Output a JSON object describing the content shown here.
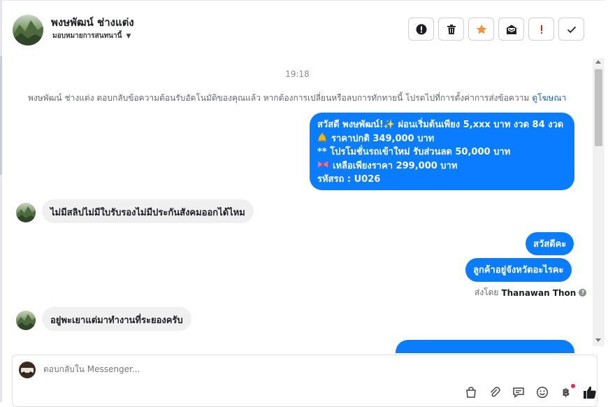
{
  "header": {
    "contact_name": "พงษพัฒน์ ช่างแต่ง",
    "assign_label": "มอบหมายการสนทนานี้"
  },
  "chat": {
    "timestamp": "19:18",
    "system_note": "พงษพัฒน์ ช่างแต่ง ตอบกลับข้อความต้อนรับอัตโนมัติของคุณแล้ว หากต้องการเปลี่ยนหรือลบการทักทายนี้ โปรดไปที่การตั้งค่าการส่งข้อความ",
    "system_link": "ดูโฆษณา",
    "promo": {
      "line1": "สวัสดี พงษพัฒน์!✨  ผ่อนเริ่มต้นเพียง 5,xxx บาท งวด 84 งวด",
      "line2": "ราคาปกติ 349,000 บาท",
      "line3": "** โปรโมชั่นรถเข้าใหม่ รับส่วนลด 50,000 บาท",
      "line4": "เหลือเพียงราคา 299,000 บาท",
      "line5": "รหัสรถ : U026"
    },
    "in_msg_1": "ไม่มีสลิปไม่มีใบรับรองไม่มีประกันสังคมออกได้ไหม",
    "out_msg_1": "สวัสดีคะ",
    "out_msg_2": "ลูกค้าอยู่จังหวัดอะไรคะ",
    "sent_by_prefix": "ส่งโดย",
    "sent_by_name": "Thanawan Thon",
    "in_msg_2": "อยู่พะเยาแต่มาทำงานที่ระยองครับ"
  },
  "composer": {
    "placeholder": "ตอบกลับใน Messenger..."
  },
  "icons": {
    "header_actions": [
      "alert-circle-icon",
      "trash-icon",
      "star-icon",
      "mail-unread-icon",
      "exclamation-icon",
      "check-icon"
    ],
    "composer_tools": [
      "bag-icon",
      "paperclip-icon",
      "saved-reply-icon",
      "emoji-icon",
      "baht-icon",
      "thumbs-up-icon"
    ]
  },
  "colors": {
    "accent_blue": "#0a7cff",
    "star_orange": "#f7923b",
    "exclaim_red": "#e02020",
    "notify_red": "#f02849"
  }
}
